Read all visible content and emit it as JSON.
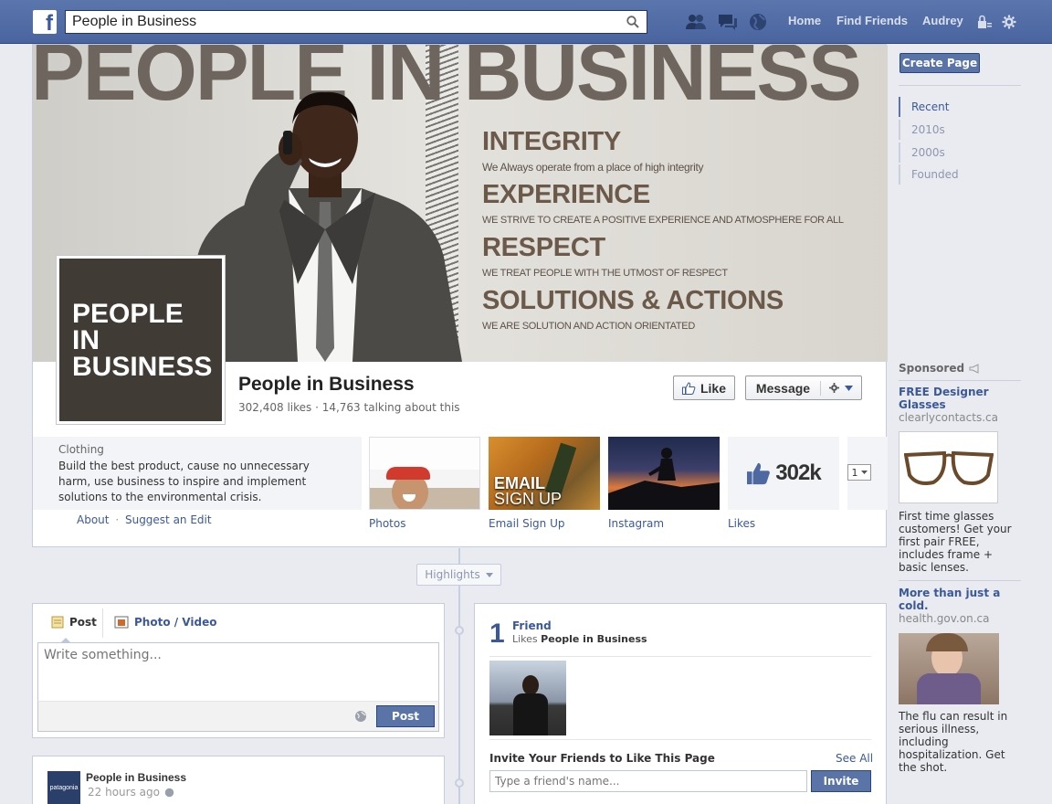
{
  "topbar": {
    "logo": "f",
    "search_value": "People in Business",
    "nav": [
      "Home",
      "Find Friends",
      "Audrey"
    ]
  },
  "cover": {
    "headline": "PEOPLE IN BUSINESS",
    "values": [
      {
        "title": "INTEGRITY",
        "sub": "We Always operate from a place of high integrity"
      },
      {
        "title": "EXPERIENCE",
        "sub": "WE STRIVE TO CREATE A POSITIVE EXPERIENCE AND ATMOSPHERE FOR ALL"
      },
      {
        "title": "RESPECT",
        "sub": "WE TREAT PEOPLE WITH THE UTMOST OF RESPECT"
      },
      {
        "title": "SOLUTIONS & ACTIONS",
        "sub": "WE ARE SOLUTION AND ACTION ORIENTATED"
      }
    ]
  },
  "profile": {
    "logo_lines": [
      "PEOPLE",
      "IN",
      "BUSINESS"
    ],
    "name": "People in Business",
    "stats": "302,408 likes · 14,763 talking about this",
    "like_label": "Like",
    "message_label": "Message"
  },
  "about": {
    "category": "Clothing",
    "description": "Build the best product, cause no unnecessary harm, use business to inspire and implement solutions to the environmental crisis.",
    "about_link": "About",
    "separator": "·",
    "edit_link": "Suggest an Edit"
  },
  "apps": [
    {
      "label": "Photos"
    },
    {
      "label": "Email Sign Up",
      "overlay1": "EMAIL",
      "overlay2": "SIGN UP"
    },
    {
      "label": "Instagram"
    },
    {
      "label": "Likes",
      "count": "302k"
    }
  ],
  "apps_more": "1",
  "highlights_label": "Highlights",
  "composer": {
    "tab_post": "Post",
    "tab_photo": "Photo / Video",
    "placeholder": "Write something...",
    "post_button": "Post"
  },
  "story": {
    "page": "People in Business",
    "time": "22 hours ago",
    "avatar_text": "patagonia"
  },
  "friends_box": {
    "count": "1",
    "title": "Friend",
    "likes_prefix": "Likes",
    "likes_page": "People in Business",
    "invite_heading": "Invite Your Friends to Like This Page",
    "see_all": "See All",
    "invite_placeholder": "Type a friend's name...",
    "invite_button": "Invite"
  },
  "rightcol": {
    "create_page": "Create Page",
    "years": [
      "Recent",
      "2010s",
      "2000s",
      "Founded"
    ],
    "sponsored": "Sponsored",
    "ads": [
      {
        "title": "FREE Designer Glasses",
        "url": "clearlycontacts.ca",
        "body": "First time glasses customers! Get your first pair FREE, includes frame + basic lenses."
      },
      {
        "title": "More than just a cold.",
        "url": "health.gov.on.ca",
        "body": "The flu can result in serious illness, including hospitalization. Get the shot."
      }
    ]
  }
}
